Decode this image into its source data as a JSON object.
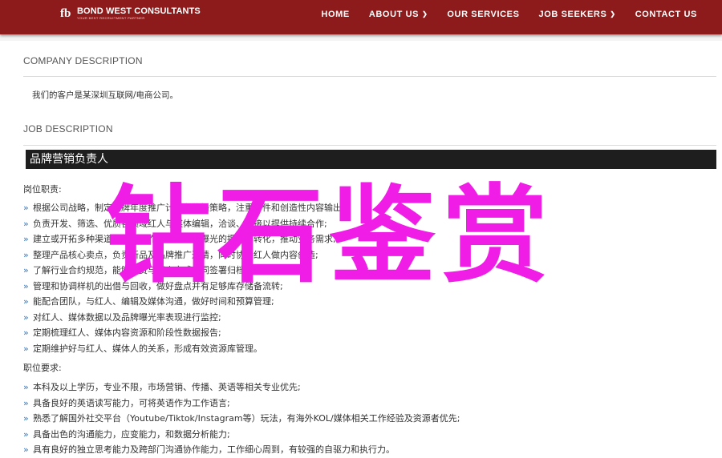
{
  "nav": {
    "logo_name": "BOND WEST CONSULTANTS",
    "logo_tagline": "YOUR BEST RECRUITMENT PARTNER",
    "items": [
      {
        "label": "HOME",
        "dropdown": false
      },
      {
        "label": "ABOUT US",
        "dropdown": true
      },
      {
        "label": "OUR SERVICES",
        "dropdown": false
      },
      {
        "label": "JOB SEEKERS",
        "dropdown": true
      },
      {
        "label": "CONTACT US",
        "dropdown": false
      }
    ]
  },
  "company": {
    "heading": "COMPANY DESCRIPTION",
    "text": "我们的客户是某深圳互联网/电商公司。"
  },
  "job": {
    "heading": "JOB DESCRIPTION",
    "position_title": "品牌营销负责人",
    "duties_heading": "岗位职责:",
    "duties": [
      "根据公司战略，制定品牌年度推广计划和传播策略，注重事件和创造性内容输出;",
      "负责开发、筛选、优质各领域红人与媒体编辑，洽谈、对接以提供持续合作;",
      "建立或开拓多种渠道的品牌合作，促进品牌曝光的提升与转化，推动业务需求;",
      "整理产品核心卖点，负责新品及品牌推广邀请，同时协助红人做内容创造;",
      "了解行业合约规范，能够付费与红人完成合同签署归档和整理;",
      "管理和协调样机的出借与回收，做好盘点并有足够库存储备流转;",
      "能配合团队，与红人、编辑及媒体沟通，做好时间和预算管理;",
      "对红人、媒体数据以及品牌曝光率表现进行监控;",
      "定期梳理红人、媒体内容资源和阶段性数据报告;",
      "定期维护好与红人、媒体人的关系，形成有效资源库管理。"
    ],
    "requirements_heading": "职位要求:",
    "requirements": [
      "本科及以上学历，专业不限，市场营销、传播、英语等相关专业优先;",
      "具备良好的英语读写能力，可将英语作为工作语言;",
      "熟悉了解国外社交平台（Youtube/Tiktok/Instagram等）玩法，有海外KOL/媒体相关工作经验及资源者优先;",
      "具备出色的沟通能力，应变能力，和数据分析能力;",
      "具有良好的独立思考能力及跨部门沟通协作能力，工作细心周到，有较强的自驱力和执行力。"
    ]
  },
  "watermark": "钻石鉴赏",
  "colors": {
    "nav_bg": "#8e1b1b",
    "banner_bg": "#1e1e1e",
    "bullet": "#3a78b6",
    "watermark": "#f01de6"
  }
}
